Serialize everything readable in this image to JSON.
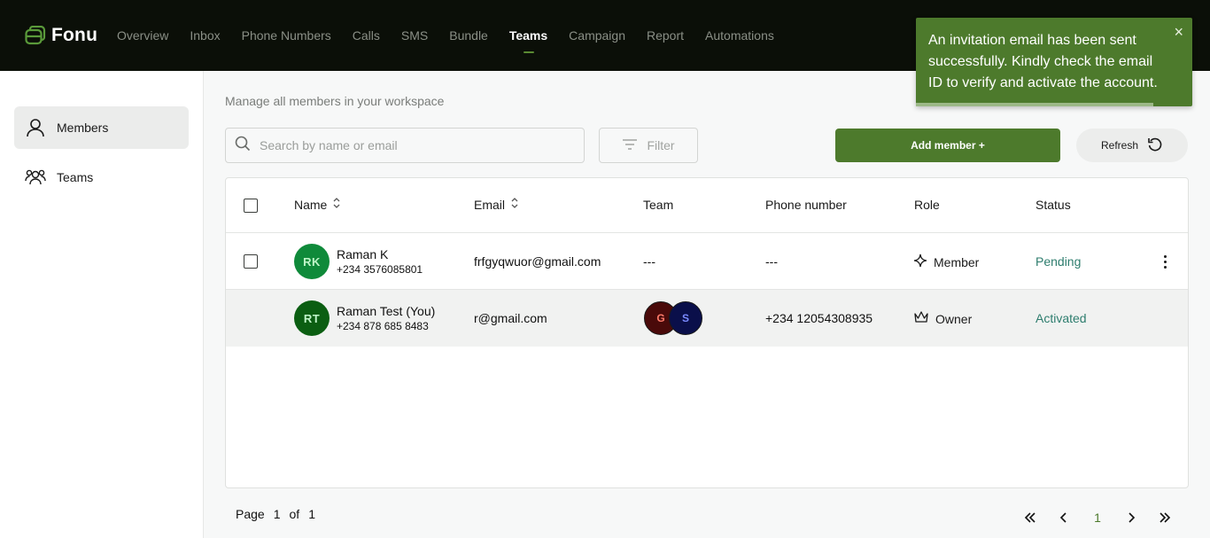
{
  "app": {
    "name": "Fonu"
  },
  "nav": [
    {
      "label": "Overview",
      "active": false
    },
    {
      "label": "Inbox",
      "active": false
    },
    {
      "label": "Phone Numbers",
      "active": false
    },
    {
      "label": "Calls",
      "active": false
    },
    {
      "label": "SMS",
      "active": false
    },
    {
      "label": "Bundle",
      "active": false
    },
    {
      "label": "Teams",
      "active": true
    },
    {
      "label": "Campaign",
      "active": false
    },
    {
      "label": "Report",
      "active": false
    },
    {
      "label": "Automations",
      "active": false
    }
  ],
  "toast": {
    "message": "An invitation email has been sent successfully. Kindly check the email ID to verify and activate the account.",
    "close": "×"
  },
  "sidebar": {
    "items": [
      {
        "label": "Members",
        "icon": "user-icon",
        "active": true
      },
      {
        "label": "Teams",
        "icon": "users-group-icon",
        "active": false
      }
    ]
  },
  "main": {
    "subtitle": "Manage all members in your workspace",
    "search_placeholder": "Search by name or email",
    "filter_label": "Filter",
    "add_member_label": "Add member +",
    "refresh_label": "Refresh"
  },
  "table": {
    "headers": {
      "name": "Name",
      "email": "Email",
      "team": "Team",
      "phone": "Phone number",
      "role": "Role",
      "status": "Status"
    },
    "rows": [
      {
        "initials": "RK",
        "name": "Raman K",
        "phone_sub": "+234 3576085801",
        "email": "frfgyqwuor@gmail.com",
        "team": "---",
        "phone": "---",
        "role": "Member",
        "status": "Pending",
        "avatar_bg": "#0f8a3a",
        "avatar_fg": "#bff5c8"
      },
      {
        "initials": "RT",
        "name": "Raman Test  (You)",
        "phone_sub": "+234 878 685 8483",
        "email": "r@gmail.com",
        "team_avatars": [
          {
            "letter": "G",
            "bg": "#4a0a0a",
            "fg": "#ff7a6a"
          },
          {
            "letter": "S",
            "bg": "#0a0f4a",
            "fg": "#7a8aff"
          }
        ],
        "phone": "+234 12054308935",
        "role": "Owner",
        "status": "Activated",
        "avatar_bg": "#0b5e12",
        "avatar_fg": "#bff5c8"
      }
    ]
  },
  "pagination": {
    "page_label": "Page",
    "current": "1",
    "of_label": "of",
    "total": "1",
    "first": "«",
    "prev": "‹",
    "page_number": "1",
    "next": "›",
    "last": "»"
  },
  "colors": {
    "brand": "#4d7a2c",
    "status_text": "#2e7d6e",
    "topbar": "#0b0f08"
  }
}
